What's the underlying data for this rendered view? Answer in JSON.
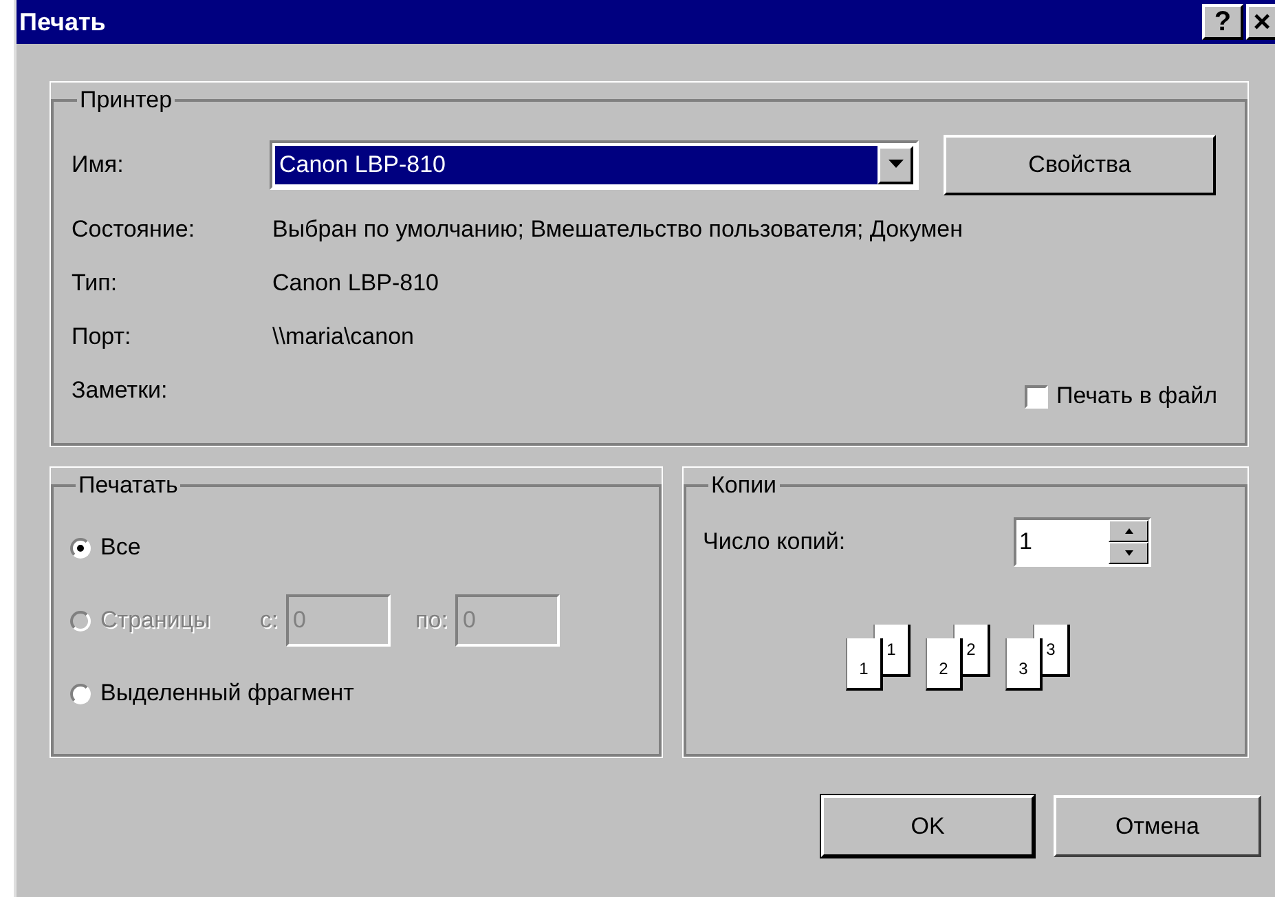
{
  "window": {
    "title": "Печать",
    "help_button": "?",
    "close_button": "×"
  },
  "printer": {
    "legend": "Принтер",
    "name_label": "Имя:",
    "name_value": "Canon LBP-810",
    "properties_button": "Свойства",
    "info": [
      {
        "label": "Состояние:",
        "value": "Выбран по умолчанию; Вмешательство пользователя; Докумен"
      },
      {
        "label": "Тип:",
        "value": "Canon LBP-810"
      },
      {
        "label": "Порт:",
        "value": "\\\\maria\\canon"
      },
      {
        "label": "Заметки:"
      }
    ],
    "print_to_file": {
      "label": "Печать в файл",
      "checked": false
    }
  },
  "print_range": {
    "legend": "Печатать",
    "options": [
      {
        "kind": "plain",
        "label": "Все",
        "selected": true,
        "disabled": false
      },
      {
        "kind": "pages",
        "label": "Страницы",
        "selected": false,
        "disabled": true,
        "from_label": "с:",
        "from_value": "0",
        "to_label": "по:",
        "to_value": "0"
      },
      {
        "kind": "plain",
        "label": "Выделенный фрагмент",
        "selected": false,
        "disabled": false
      }
    ]
  },
  "copies": {
    "legend": "Копии",
    "count_label": "Число копий:",
    "count_value": "1",
    "collate_stacks": [
      {
        "back": "1",
        "front": "1"
      },
      {
        "back": "2",
        "front": "2"
      },
      {
        "back": "3",
        "front": "3"
      }
    ]
  },
  "buttons": [
    {
      "label": "OK",
      "default": true
    },
    {
      "label": "Отмена",
      "default": false
    }
  ]
}
